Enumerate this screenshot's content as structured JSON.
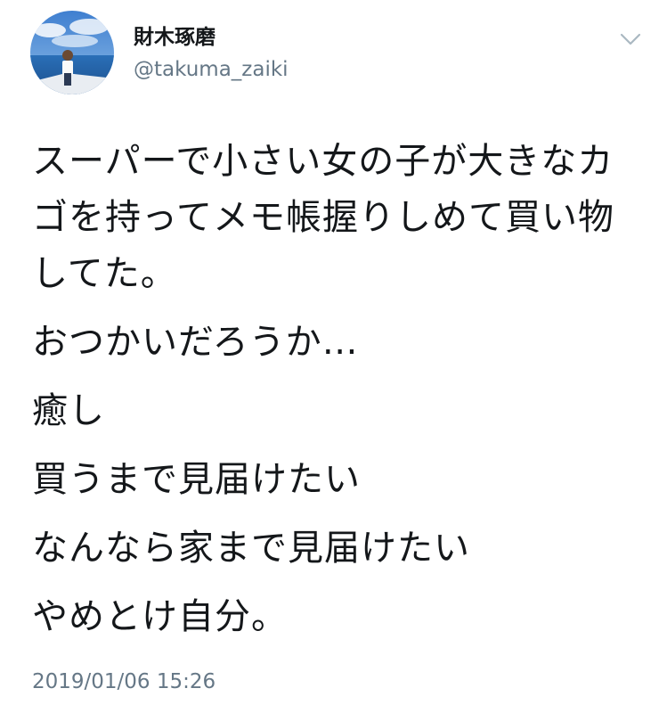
{
  "author": {
    "display_name": "財木琢磨",
    "handle": "@takuma_zaiki"
  },
  "menu": {
    "icon": "chevron-down-icon"
  },
  "tweet": {
    "paragraphs": [
      "スーパーで小さい女の子が大きなカゴを持ってメモ帳握りしめて買い物してた。",
      "おつかいだろうか…",
      "癒し",
      "買うまで見届けたい",
      "なんなら家まで見届けたい",
      "やめとけ自分。"
    ],
    "timestamp": "2019/01/06 15:26"
  },
  "colors": {
    "text": "#14171a",
    "secondary": "#657786",
    "chevron": "#aab8c2"
  }
}
